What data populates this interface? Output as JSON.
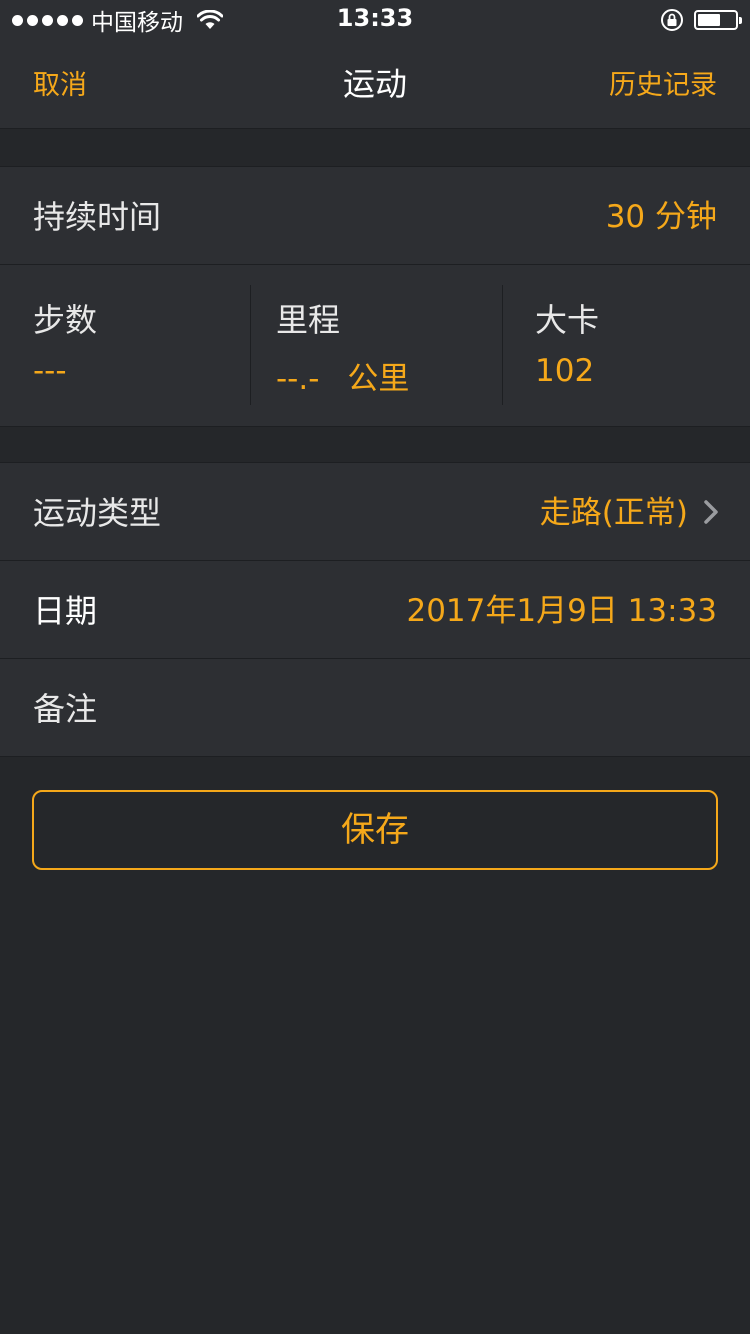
{
  "status_bar": {
    "carrier": "中国移动",
    "time": "13:33",
    "battery_level": 0.6
  },
  "nav": {
    "cancel_label": "取消",
    "title": "运动",
    "history_label": "历史记录"
  },
  "duration": {
    "label": "持续时间",
    "value": "30 分钟"
  },
  "stats": {
    "steps": {
      "label": "步数",
      "value": "---"
    },
    "distance": {
      "label": "里程",
      "value": "--.-",
      "unit": "公里"
    },
    "calories": {
      "label": "大卡",
      "value": "102"
    }
  },
  "details": {
    "type": {
      "label": "运动类型",
      "value": "走路(正常)"
    },
    "date": {
      "label": "日期",
      "value": "2017年1月9日 13:33"
    },
    "note": {
      "label": "备注"
    }
  },
  "save_label": "保存",
  "colors": {
    "accent": "#f5a81a",
    "background": "#25272a",
    "panel": "#2d2f33"
  }
}
